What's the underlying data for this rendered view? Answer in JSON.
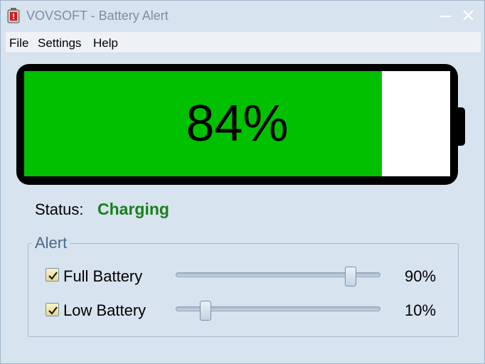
{
  "window": {
    "title": "VOVSOFT - Battery Alert"
  },
  "menu": [
    "File",
    "Settings",
    "Help"
  ],
  "battery": {
    "level_percent": 84,
    "label": "84%",
    "fill_color": "#00c000"
  },
  "status": {
    "label": "Status:",
    "value": "Charging",
    "value_color": "#1a7f1a"
  },
  "alert": {
    "legend": "Alert",
    "rows": [
      {
        "label": "Full Battery",
        "checked": true,
        "slider_percent": 90,
        "value": "90%"
      },
      {
        "label": "Low Battery",
        "checked": true,
        "slider_percent": 10,
        "value": "10%"
      }
    ]
  },
  "icons": {
    "app": "battery-alert-app-icon",
    "minimize": "minimize-icon",
    "close": "close-icon",
    "check": "checkmark-icon"
  }
}
